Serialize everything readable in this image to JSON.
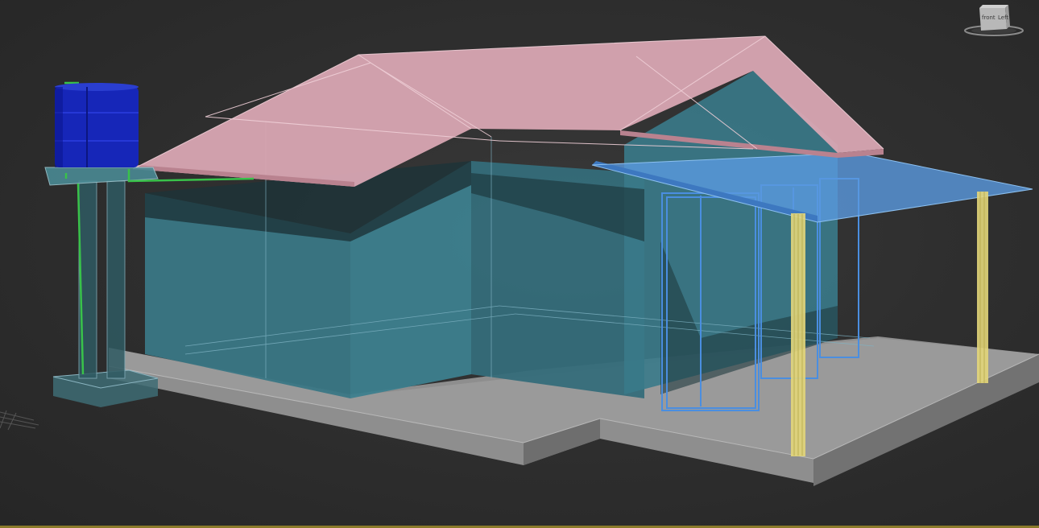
{
  "viewport": {
    "name": "3d-perspective-viewport",
    "background_color": "#2b2b2b"
  },
  "viewcube": {
    "front_label": "front",
    "side_label": "Left",
    "icon": "viewcube-icon"
  },
  "scene": {
    "colors": {
      "roof": "#d9a6b3",
      "walls": "#3f7f8f",
      "porch_roof": "#4f8fd9",
      "porch_frames": "#4a8ee0",
      "columns": "#e8d87a",
      "water_tanks": "#1020b0",
      "pipes": "#39c24a",
      "tower": "#4a8a94",
      "slab": "#8a8a8a",
      "wire": "#a0c8e0"
    },
    "objects": [
      "roof-mesh",
      "house-walls",
      "porch-roof",
      "porch-columns",
      "water-tanks",
      "water-tower",
      "foundation-slab"
    ]
  }
}
